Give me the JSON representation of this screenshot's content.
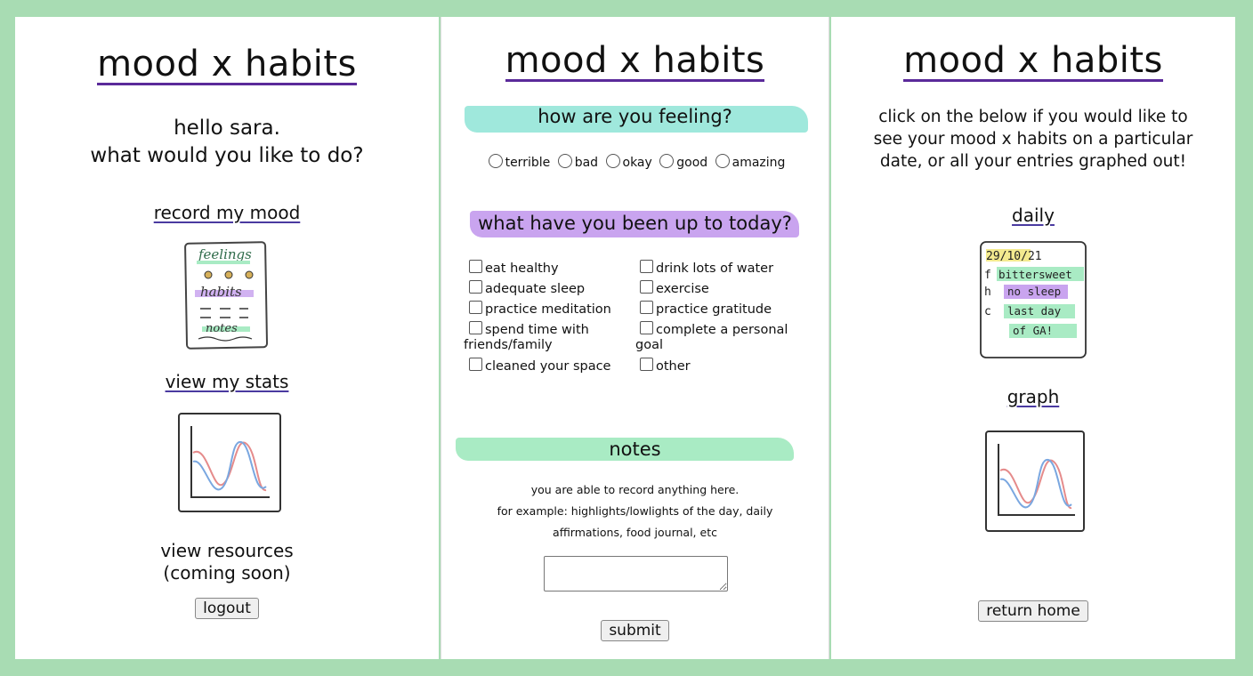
{
  "app_title": "mood x habits",
  "home": {
    "greeting": "hello sara.",
    "question": "what would you like to do?",
    "record_link": "record my mood",
    "stats_link": "view my stats",
    "resources_line1": "view resources",
    "resources_line2": "(coming soon)",
    "logout_label": "logout",
    "sketch_words": {
      "feelings": "feelings",
      "habits": "habits",
      "notes": "notes"
    }
  },
  "record": {
    "feeling_heading": "how are you feeling?",
    "moods": [
      "terrible",
      "bad",
      "okay",
      "good",
      "amazing"
    ],
    "habits_heading": "what have you been up to today?",
    "habits_left": [
      "eat healthy",
      "adequate sleep",
      "practice meditation",
      "spend time with",
      "cleaned your space"
    ],
    "habits_left_wrap": "friends/family",
    "habits_right": [
      "drink lots of water",
      "exercise",
      "practice gratitude",
      "complete a personal",
      "other"
    ],
    "habits_right_wrap": "goal",
    "notes_heading": "notes",
    "notes_line1": "you are able to record anything here.",
    "notes_line2": "for example: highlights/lowlights of the day, daily",
    "notes_line3": "affirmations, food journal, etc",
    "notes_value": "",
    "submit_label": "submit"
  },
  "view": {
    "intro_line1": "click on the below if you would like to",
    "intro_line2": "see your mood x habits on a particular",
    "intro_line3": "date, or all your entries graphed out!",
    "daily_link": "daily",
    "graph_link": "graph",
    "return_label": "return home",
    "daily_sketch": {
      "date": "29/10/21",
      "f_label": "f",
      "f_text": "bittersweet",
      "h_label": "h",
      "h_text": "no sleep",
      "c_label": "c",
      "c_text1": "last day",
      "c_text2": "of GA!"
    }
  },
  "colors": {
    "background": "#a8dcb3",
    "teal_brush": "#9fe8dc",
    "purple_brush": "#c9a4ef",
    "green_brush": "#a9ebc4",
    "underline": "#5b2a9a"
  }
}
